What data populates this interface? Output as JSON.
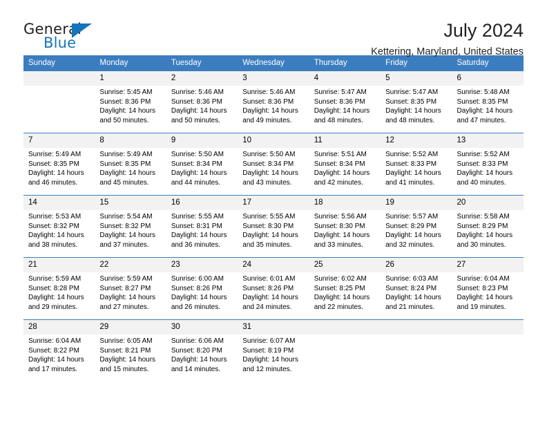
{
  "brand": {
    "name_part1": "General",
    "name_part2": "Blue",
    "flag_icon": "triangle-flag-icon"
  },
  "header": {
    "title": "July 2024",
    "subtitle": "Kettering, Maryland, United States"
  },
  "theme": {
    "header_bg": "#3b7dbf",
    "daynum_bg": "#f2f2f2",
    "brand_blue": "#1574bb",
    "text": "#000000"
  },
  "calendar": {
    "weekday_headers": [
      "Sunday",
      "Monday",
      "Tuesday",
      "Wednesday",
      "Thursday",
      "Friday",
      "Saturday"
    ],
    "labels": {
      "sunrise_prefix": "Sunrise:",
      "sunset_prefix": "Sunset:",
      "daylight_prefix": "Daylight:"
    },
    "weeks": [
      [
        {
          "day": "",
          "empty": true
        },
        {
          "day": "1",
          "sunrise": "Sunrise: 5:45 AM",
          "sunset": "Sunset: 8:36 PM",
          "daylight_line1": "Daylight: 14 hours",
          "daylight_line2": "and 50 minutes."
        },
        {
          "day": "2",
          "sunrise": "Sunrise: 5:46 AM",
          "sunset": "Sunset: 8:36 PM",
          "daylight_line1": "Daylight: 14 hours",
          "daylight_line2": "and 50 minutes."
        },
        {
          "day": "3",
          "sunrise": "Sunrise: 5:46 AM",
          "sunset": "Sunset: 8:36 PM",
          "daylight_line1": "Daylight: 14 hours",
          "daylight_line2": "and 49 minutes."
        },
        {
          "day": "4",
          "sunrise": "Sunrise: 5:47 AM",
          "sunset": "Sunset: 8:36 PM",
          "daylight_line1": "Daylight: 14 hours",
          "daylight_line2": "and 48 minutes."
        },
        {
          "day": "5",
          "sunrise": "Sunrise: 5:47 AM",
          "sunset": "Sunset: 8:35 PM",
          "daylight_line1": "Daylight: 14 hours",
          "daylight_line2": "and 48 minutes."
        },
        {
          "day": "6",
          "sunrise": "Sunrise: 5:48 AM",
          "sunset": "Sunset: 8:35 PM",
          "daylight_line1": "Daylight: 14 hours",
          "daylight_line2": "and 47 minutes."
        }
      ],
      [
        {
          "day": "7",
          "sunrise": "Sunrise: 5:49 AM",
          "sunset": "Sunset: 8:35 PM",
          "daylight_line1": "Daylight: 14 hours",
          "daylight_line2": "and 46 minutes."
        },
        {
          "day": "8",
          "sunrise": "Sunrise: 5:49 AM",
          "sunset": "Sunset: 8:35 PM",
          "daylight_line1": "Daylight: 14 hours",
          "daylight_line2": "and 45 minutes."
        },
        {
          "day": "9",
          "sunrise": "Sunrise: 5:50 AM",
          "sunset": "Sunset: 8:34 PM",
          "daylight_line1": "Daylight: 14 hours",
          "daylight_line2": "and 44 minutes."
        },
        {
          "day": "10",
          "sunrise": "Sunrise: 5:50 AM",
          "sunset": "Sunset: 8:34 PM",
          "daylight_line1": "Daylight: 14 hours",
          "daylight_line2": "and 43 minutes."
        },
        {
          "day": "11",
          "sunrise": "Sunrise: 5:51 AM",
          "sunset": "Sunset: 8:34 PM",
          "daylight_line1": "Daylight: 14 hours",
          "daylight_line2": "and 42 minutes."
        },
        {
          "day": "12",
          "sunrise": "Sunrise: 5:52 AM",
          "sunset": "Sunset: 8:33 PM",
          "daylight_line1": "Daylight: 14 hours",
          "daylight_line2": "and 41 minutes."
        },
        {
          "day": "13",
          "sunrise": "Sunrise: 5:52 AM",
          "sunset": "Sunset: 8:33 PM",
          "daylight_line1": "Daylight: 14 hours",
          "daylight_line2": "and 40 minutes."
        }
      ],
      [
        {
          "day": "14",
          "sunrise": "Sunrise: 5:53 AM",
          "sunset": "Sunset: 8:32 PM",
          "daylight_line1": "Daylight: 14 hours",
          "daylight_line2": "and 38 minutes."
        },
        {
          "day": "15",
          "sunrise": "Sunrise: 5:54 AM",
          "sunset": "Sunset: 8:32 PM",
          "daylight_line1": "Daylight: 14 hours",
          "daylight_line2": "and 37 minutes."
        },
        {
          "day": "16",
          "sunrise": "Sunrise: 5:55 AM",
          "sunset": "Sunset: 8:31 PM",
          "daylight_line1": "Daylight: 14 hours",
          "daylight_line2": "and 36 minutes."
        },
        {
          "day": "17",
          "sunrise": "Sunrise: 5:55 AM",
          "sunset": "Sunset: 8:30 PM",
          "daylight_line1": "Daylight: 14 hours",
          "daylight_line2": "and 35 minutes."
        },
        {
          "day": "18",
          "sunrise": "Sunrise: 5:56 AM",
          "sunset": "Sunset: 8:30 PM",
          "daylight_line1": "Daylight: 14 hours",
          "daylight_line2": "and 33 minutes."
        },
        {
          "day": "19",
          "sunrise": "Sunrise: 5:57 AM",
          "sunset": "Sunset: 8:29 PM",
          "daylight_line1": "Daylight: 14 hours",
          "daylight_line2": "and 32 minutes."
        },
        {
          "day": "20",
          "sunrise": "Sunrise: 5:58 AM",
          "sunset": "Sunset: 8:29 PM",
          "daylight_line1": "Daylight: 14 hours",
          "daylight_line2": "and 30 minutes."
        }
      ],
      [
        {
          "day": "21",
          "sunrise": "Sunrise: 5:59 AM",
          "sunset": "Sunset: 8:28 PM",
          "daylight_line1": "Daylight: 14 hours",
          "daylight_line2": "and 29 minutes."
        },
        {
          "day": "22",
          "sunrise": "Sunrise: 5:59 AM",
          "sunset": "Sunset: 8:27 PM",
          "daylight_line1": "Daylight: 14 hours",
          "daylight_line2": "and 27 minutes."
        },
        {
          "day": "23",
          "sunrise": "Sunrise: 6:00 AM",
          "sunset": "Sunset: 8:26 PM",
          "daylight_line1": "Daylight: 14 hours",
          "daylight_line2": "and 26 minutes."
        },
        {
          "day": "24",
          "sunrise": "Sunrise: 6:01 AM",
          "sunset": "Sunset: 8:26 PM",
          "daylight_line1": "Daylight: 14 hours",
          "daylight_line2": "and 24 minutes."
        },
        {
          "day": "25",
          "sunrise": "Sunrise: 6:02 AM",
          "sunset": "Sunset: 8:25 PM",
          "daylight_line1": "Daylight: 14 hours",
          "daylight_line2": "and 22 minutes."
        },
        {
          "day": "26",
          "sunrise": "Sunrise: 6:03 AM",
          "sunset": "Sunset: 8:24 PM",
          "daylight_line1": "Daylight: 14 hours",
          "daylight_line2": "and 21 minutes."
        },
        {
          "day": "27",
          "sunrise": "Sunrise: 6:04 AM",
          "sunset": "Sunset: 8:23 PM",
          "daylight_line1": "Daylight: 14 hours",
          "daylight_line2": "and 19 minutes."
        }
      ],
      [
        {
          "day": "28",
          "sunrise": "Sunrise: 6:04 AM",
          "sunset": "Sunset: 8:22 PM",
          "daylight_line1": "Daylight: 14 hours",
          "daylight_line2": "and 17 minutes."
        },
        {
          "day": "29",
          "sunrise": "Sunrise: 6:05 AM",
          "sunset": "Sunset: 8:21 PM",
          "daylight_line1": "Daylight: 14 hours",
          "daylight_line2": "and 15 minutes."
        },
        {
          "day": "30",
          "sunrise": "Sunrise: 6:06 AM",
          "sunset": "Sunset: 8:20 PM",
          "daylight_line1": "Daylight: 14 hours",
          "daylight_line2": "and 14 minutes."
        },
        {
          "day": "31",
          "sunrise": "Sunrise: 6:07 AM",
          "sunset": "Sunset: 8:19 PM",
          "daylight_line1": "Daylight: 14 hours",
          "daylight_line2": "and 12 minutes."
        },
        {
          "day": "",
          "empty": true
        },
        {
          "day": "",
          "empty": true
        },
        {
          "day": "",
          "empty": true
        }
      ]
    ]
  }
}
